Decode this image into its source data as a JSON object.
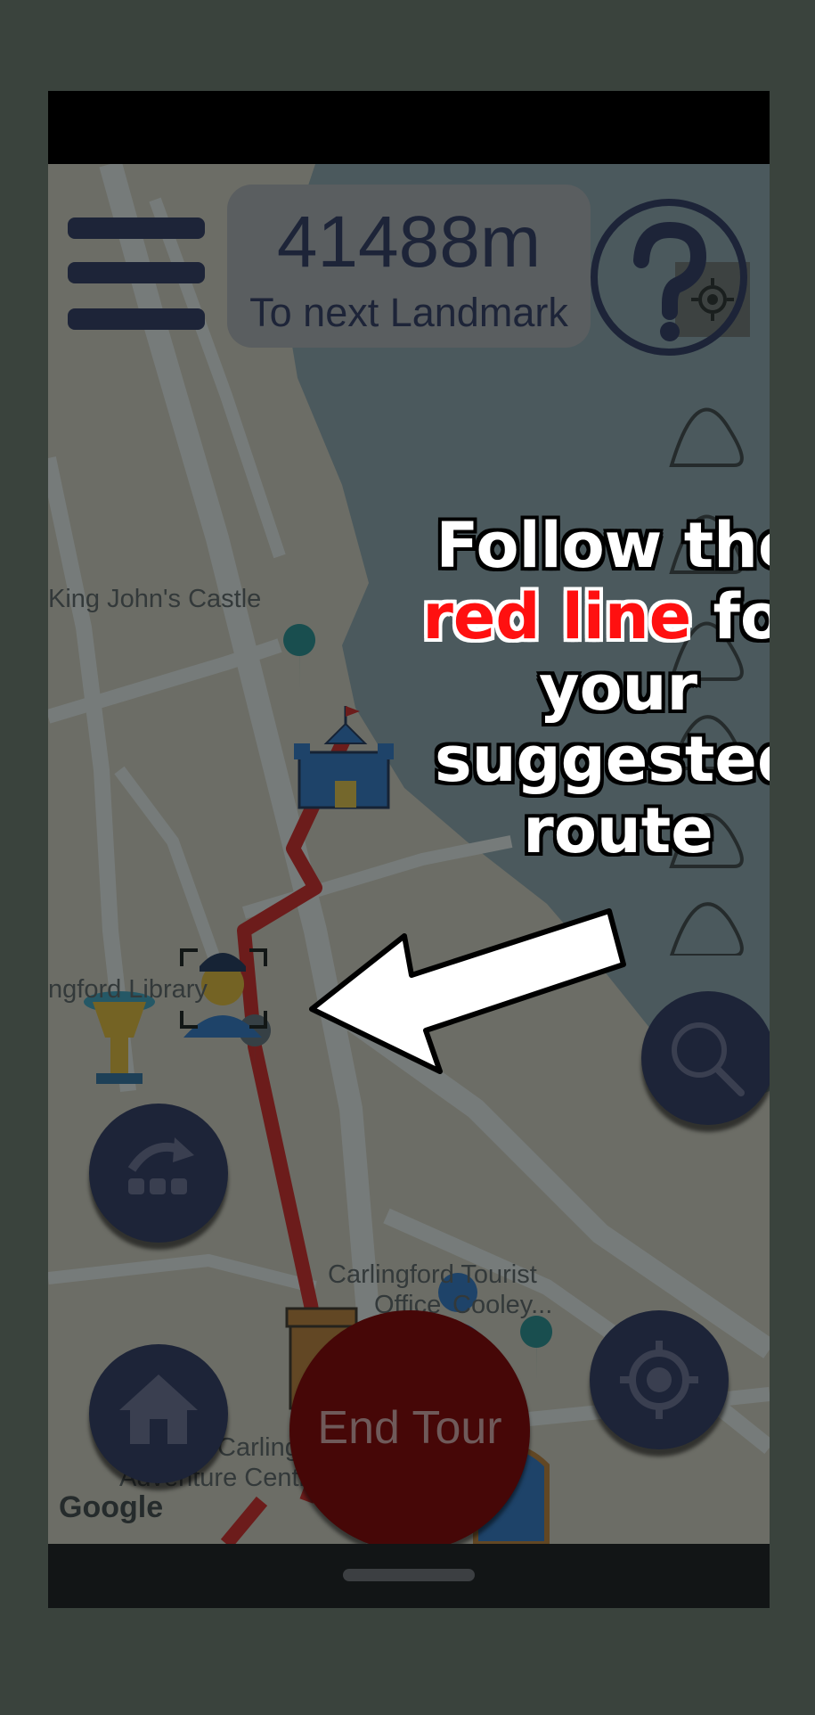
{
  "distance": {
    "value": "41488m",
    "caption": "To next Landmark"
  },
  "map": {
    "labels": {
      "king_johns_castle": "King John's Castle",
      "library": "ngford Library",
      "tourist_office_1": "Carlingford Tourist",
      "tourist_office_2": "Office",
      "cooley": "Cooley...",
      "adventure_1": "Carlingfo",
      "adventure_2": "Adventure Centr"
    },
    "google_logo": "Google",
    "route_color": "#d81c1c"
  },
  "tutorial": {
    "line1": "Follow the",
    "highlight": "red line",
    "line2_rest": " for",
    "line3": "your",
    "line4": "suggested",
    "line5": "route"
  },
  "buttons": {
    "end_tour": "End Tour"
  },
  "colors": {
    "button_dark": "#1d2438",
    "end_tour": "#460707",
    "highlight_red": "#ff1010"
  },
  "icons": [
    "menu-icon",
    "help-icon",
    "my-location-icon",
    "search-icon",
    "reroute-icon",
    "home-icon",
    "crosshair-icon"
  ]
}
